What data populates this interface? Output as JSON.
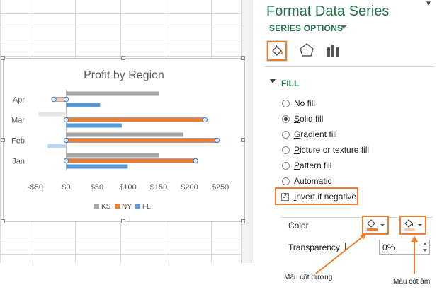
{
  "pane": {
    "title": "Format Data Series",
    "close_icon": "dropdown-arrow",
    "series_options_label": "SERIES OPTIONS",
    "fill_section_label": "FILL",
    "fill_options": [
      {
        "label": "No fill",
        "ul": "N",
        "rest": "o fill",
        "selected": false
      },
      {
        "label": "Solid fill",
        "ul": "S",
        "rest": "olid fill",
        "selected": true
      },
      {
        "label": "Gradient fill",
        "ul": "G",
        "rest": "radient fill",
        "selected": false
      },
      {
        "label": "Picture or texture fill",
        "ul": "P",
        "rest": "icture or texture fill",
        "selected": false
      },
      {
        "label": "Pattern fill",
        "ul": "P",
        "rest": "attern fill",
        "selected": false
      },
      {
        "label": "Automatic",
        "ul": "",
        "rest": "Automatic",
        "selected": false
      }
    ],
    "invert_if_negative": {
      "label_ul": "I",
      "label_rest": "nvert if negative",
      "checked": true
    },
    "color_label": "Color",
    "transparency_label": "Transparency",
    "transparency_value": "0%",
    "positive_color": "#ed7d31",
    "negative_color": "#f8cbad",
    "accent_color": "#217346",
    "highlight_color": "#f08030"
  },
  "annotations": {
    "positive_label": "Màu cột dương",
    "negative_label": "Màu cột âm"
  },
  "chart_data": {
    "type": "bar",
    "orientation": "horizontal",
    "title": "Profit by Region",
    "categories": [
      "Jan",
      "Feb",
      "Mar",
      "Apr"
    ],
    "series": [
      {
        "name": "KS",
        "color": "#a5a5a5",
        "values": [
          150,
          190,
          -45,
          150
        ]
      },
      {
        "name": "NY",
        "color": "#ed7d31",
        "values": [
          210,
          245,
          225,
          -20
        ]
      },
      {
        "name": "FL",
        "color": "#5b9bd5",
        "values": [
          100,
          -30,
          90,
          55
        ]
      }
    ],
    "xlim": [
      -50,
      250
    ],
    "xticks": [
      "-$50",
      "$0",
      "$50",
      "$100",
      "$150",
      "$200",
      "$250"
    ],
    "xtick_values": [
      -50,
      0,
      50,
      100,
      150,
      200,
      250
    ],
    "legend_position": "bottom",
    "selected_series": "NY",
    "invert_if_negative": true
  }
}
